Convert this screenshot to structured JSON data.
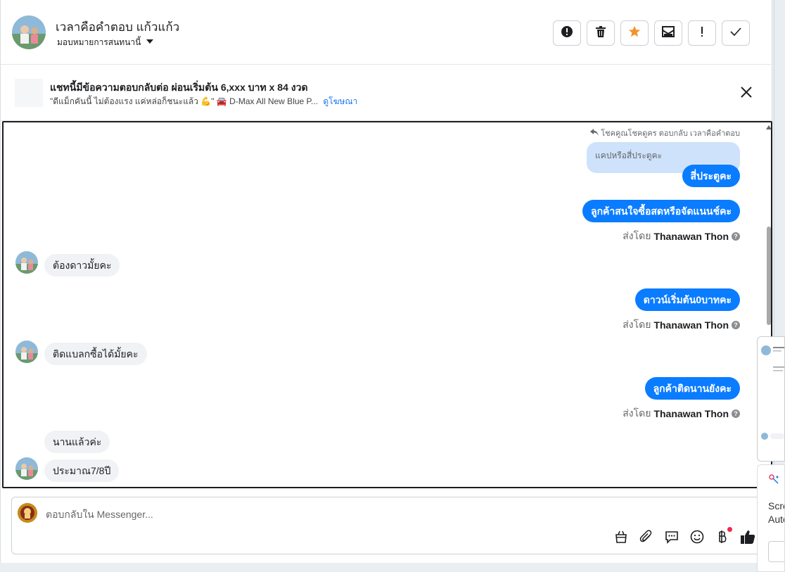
{
  "header": {
    "contact_name": "เวลาคือคำตอบ แก้วแก้ว",
    "assign_label": "มอบหมายการสนทนานี้",
    "toolbar": [
      {
        "name": "alert-icon"
      },
      {
        "name": "trash-icon"
      },
      {
        "name": "star-icon"
      },
      {
        "name": "mark-unread-icon"
      },
      {
        "name": "exclamation-icon"
      },
      {
        "name": "check-icon"
      }
    ]
  },
  "ad_banner": {
    "title": "แชทนี้มีข้อความตอบกลับต่อ ผ่อนเริ่มต้น 6,xxx บาท x 84 งวด",
    "subtitle": "\"ดีแม็กคันนี้ ไม่ต้องแรง แค่หล่อก็ชนะแล้ว 💪\" 🚘 D-Max All New Blue P...",
    "link": "ดูโฆษณา"
  },
  "messages": {
    "reply_header": "โชคคูณโชคดูคร ตอบกลับ เวลาคือคำตอบ",
    "quoted": "แคปหรือสี่ประตูคะ",
    "out1": "สี่ประตูคะ",
    "out2": "ลูกค้าสนใจซื้อสดหรือจัดแนนช์คะ",
    "sent_by_prefix": "ส่งโดย",
    "sent_by_name": "Thanawan Thon",
    "in1": "ต้องดาวมั้ยคะ",
    "out3": "ดาวน์เริ่มต้น0บาทคะ",
    "in2": "ติดแบลกซื้อได้มั้ยคะ",
    "out4": "ลูกค้าติดนานยังคะ",
    "in3": "นานแล้วค่ะ",
    "in4": "ประมาณ7/8ปี"
  },
  "composer": {
    "placeholder": "ตอบกลับใน Messenger..."
  },
  "side_popup": {
    "text1": "Scre",
    "text2": "Auto"
  },
  "colors": {
    "outgoing_bubble": "#0a7cff",
    "incoming_bubble": "#f0f2f5",
    "quoted_bubble": "#cfe2fb",
    "star": "#f5922b",
    "link": "#1877f2"
  }
}
